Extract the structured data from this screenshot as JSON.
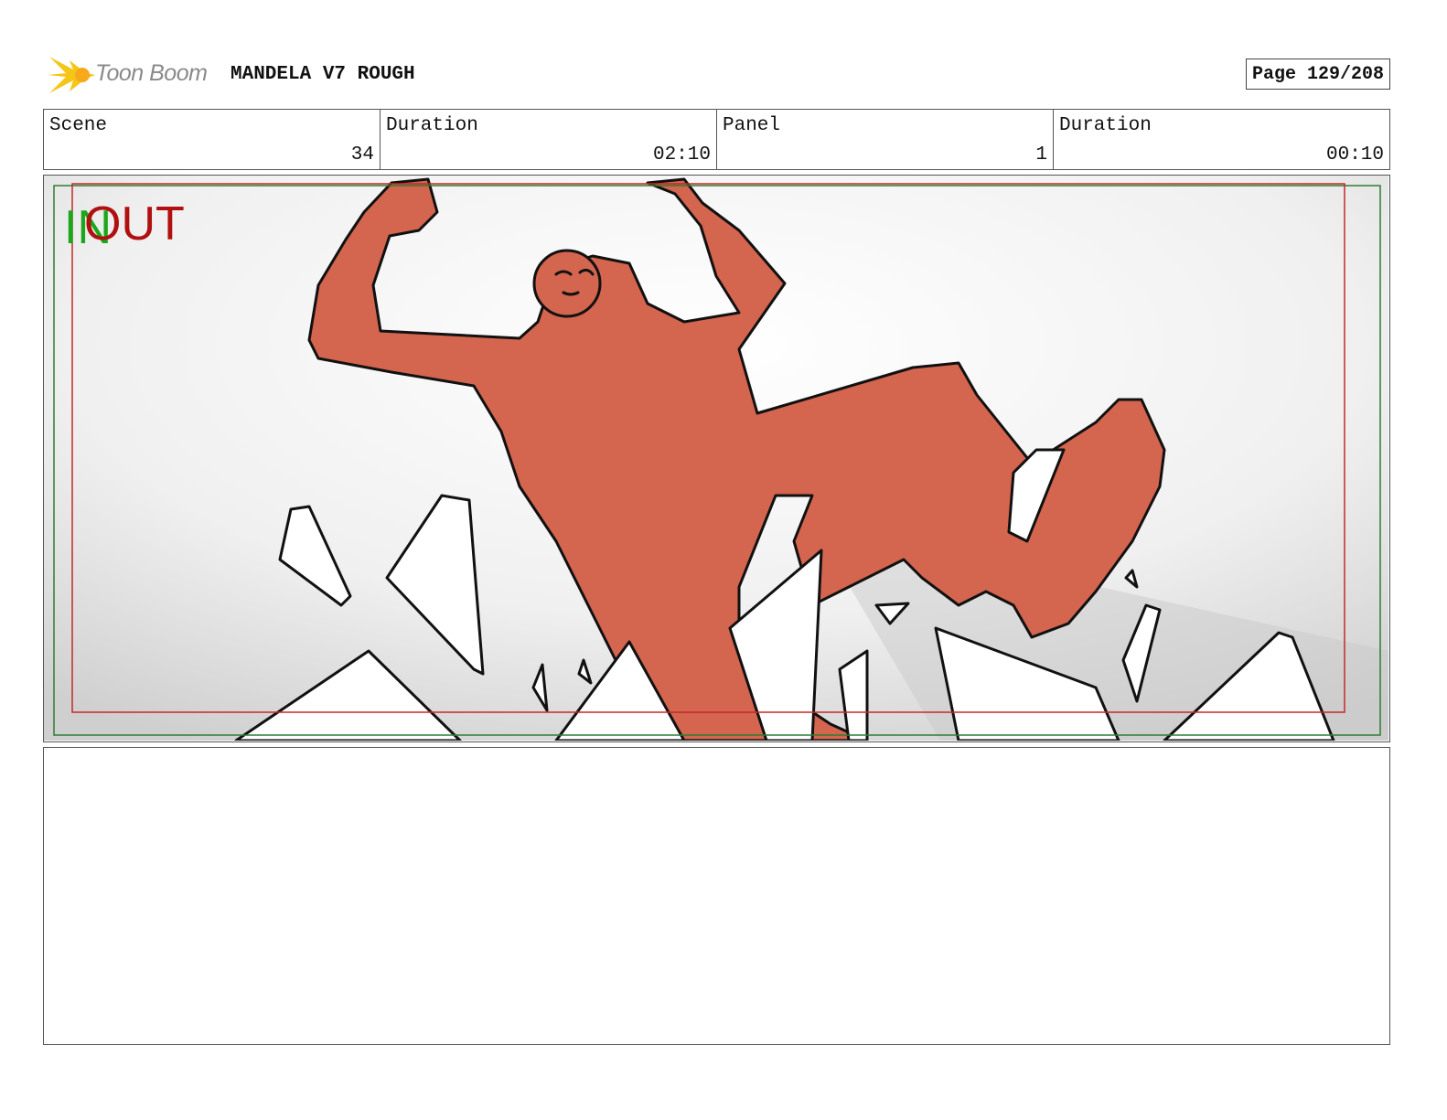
{
  "header": {
    "brand": "Toon Boom",
    "project_title": "MANDELA V7 ROUGH",
    "page_label": "Page 129/208"
  },
  "info": {
    "scene_label": "Scene",
    "scene_value": "34",
    "duration_label": "Duration",
    "duration_value": "02:10",
    "panel_label": "Panel",
    "panel_value": "1",
    "panel_duration_label": "Duration",
    "panel_duration_value": "00:10"
  },
  "panel": {
    "in_marker": "IN",
    "out_marker": "OUT",
    "colors": {
      "figure": "#d4654f",
      "in": "#1aa81a",
      "out": "#b01010",
      "safe_frame_outer": "#2e7d32",
      "safe_frame_inner": "#c62828"
    }
  },
  "notes": {
    "text": ""
  }
}
